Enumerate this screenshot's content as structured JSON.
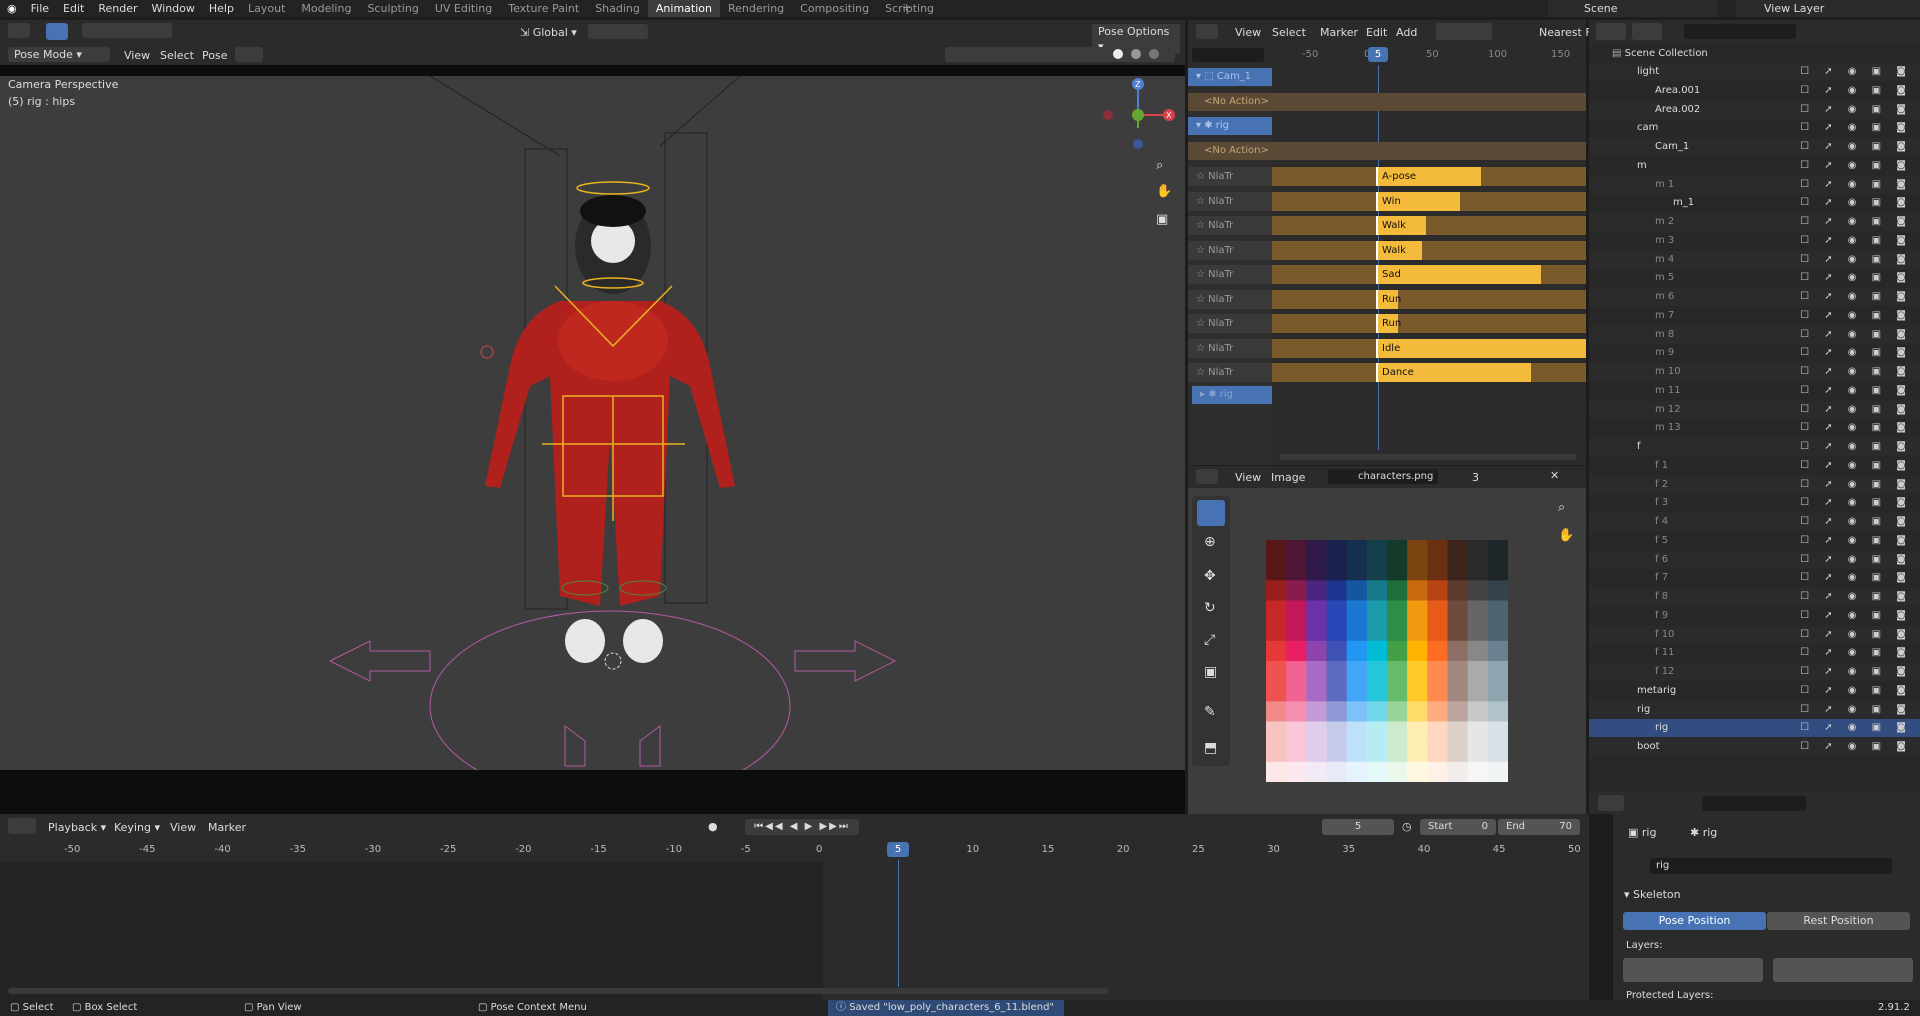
{
  "menu": {
    "file": "File",
    "edit": "Edit",
    "render": "Render",
    "window": "Window",
    "help": "Help"
  },
  "workspaces": [
    "Layout",
    "Modeling",
    "Sculpting",
    "UV Editing",
    "Texture Paint",
    "Shading",
    "Animation",
    "Rendering",
    "Compositing",
    "Scripting"
  ],
  "active_workspace": "Animation",
  "scene_label": "Scene",
  "view_layer_label": "View Layer",
  "viewport": {
    "mode": "Pose Mode",
    "view": "View",
    "select": "Select",
    "pose": "Pose",
    "transform": "Global",
    "pose_options": "Pose Options",
    "info_line1": "Camera Perspective",
    "info_line2": "(5) rig : hips"
  },
  "nla": {
    "view": "View",
    "select": "Select",
    "marker": "Marker",
    "edit": "Edit",
    "add": "Add",
    "snap": "Nearest F",
    "ticks": [
      "-50",
      "0",
      "50",
      "100",
      "150"
    ],
    "frame": "5",
    "objects": [
      {
        "name": "Cam_1"
      },
      {
        "name": "rig"
      }
    ],
    "no_action": "<No Action>",
    "track_label": "NlaTr",
    "strips": [
      "A-pose",
      "Win",
      "Walk (RM)",
      "Walk",
      "Sad",
      "Run (",
      "Run",
      "Idle",
      "Dance"
    ],
    "rig_sub": "rig"
  },
  "image_editor": {
    "view": "View",
    "image": "Image",
    "filename": "characters.png",
    "users": "3"
  },
  "outliner": {
    "root": "Scene Collection",
    "rows": [
      {
        "label": "light",
        "indent": 1
      },
      {
        "label": "Area.001",
        "indent": 2
      },
      {
        "label": "Area.002",
        "indent": 2
      },
      {
        "label": "cam",
        "indent": 1
      },
      {
        "label": "Cam_1",
        "indent": 2
      },
      {
        "label": "m",
        "indent": 1
      },
      {
        "label": "m 1",
        "indent": 2
      },
      {
        "label": "m_1",
        "indent": 3
      },
      {
        "label": "m 2",
        "indent": 2
      },
      {
        "label": "m 3",
        "indent": 2
      },
      {
        "label": "m 4",
        "indent": 2
      },
      {
        "label": "m 5",
        "indent": 2
      },
      {
        "label": "m 6",
        "indent": 2
      },
      {
        "label": "m 7",
        "indent": 2
      },
      {
        "label": "m 8",
        "indent": 2
      },
      {
        "label": "m 9",
        "indent": 2
      },
      {
        "label": "m 10",
        "indent": 2
      },
      {
        "label": "m 11",
        "indent": 2
      },
      {
        "label": "m 12",
        "indent": 2
      },
      {
        "label": "m 13",
        "indent": 2
      },
      {
        "label": "f",
        "indent": 1
      },
      {
        "label": "f 1",
        "indent": 2
      },
      {
        "label": "f 2",
        "indent": 2
      },
      {
        "label": "f 3",
        "indent": 2
      },
      {
        "label": "f 4",
        "indent": 2
      },
      {
        "label": "f 5",
        "indent": 2
      },
      {
        "label": "f 6",
        "indent": 2
      },
      {
        "label": "f 7",
        "indent": 2
      },
      {
        "label": "f 8",
        "indent": 2
      },
      {
        "label": "f 9",
        "indent": 2
      },
      {
        "label": "f 10",
        "indent": 2
      },
      {
        "label": "f 11",
        "indent": 2
      },
      {
        "label": "f 12",
        "indent": 2
      },
      {
        "label": "metarig",
        "indent": 1
      },
      {
        "label": "rig",
        "indent": 1
      },
      {
        "label": "rig",
        "indent": 2
      },
      {
        "label": "boot",
        "indent": 1
      }
    ]
  },
  "properties": {
    "object": "rig",
    "data": "rig",
    "name_field": "rig",
    "panel": "Skeleton",
    "pose_position": "Pose Position",
    "rest_position": "Rest Position",
    "layers": "Layers:",
    "protected": "Protected Layers:"
  },
  "timeline": {
    "playback": "Playback",
    "keying": "Keying",
    "view": "View",
    "marker": "Marker",
    "current": "5",
    "start_label": "Start",
    "start": "0",
    "end_label": "End",
    "end": "70",
    "ticks": [
      "-50",
      "-45",
      "-40",
      "-35",
      "-30",
      "-25",
      "-20",
      "-15",
      "-10",
      "-5",
      "0",
      "5",
      "10",
      "15",
      "20",
      "25",
      "30",
      "35",
      "40",
      "45",
      "50"
    ]
  },
  "status": {
    "select": "Select",
    "box_select": "Box Select",
    "pan_view": "Pan View",
    "context": "Pose Context Menu",
    "saved": "Saved \"low_poly_characters_6_11.blend\"",
    "version": "2.91.2"
  }
}
